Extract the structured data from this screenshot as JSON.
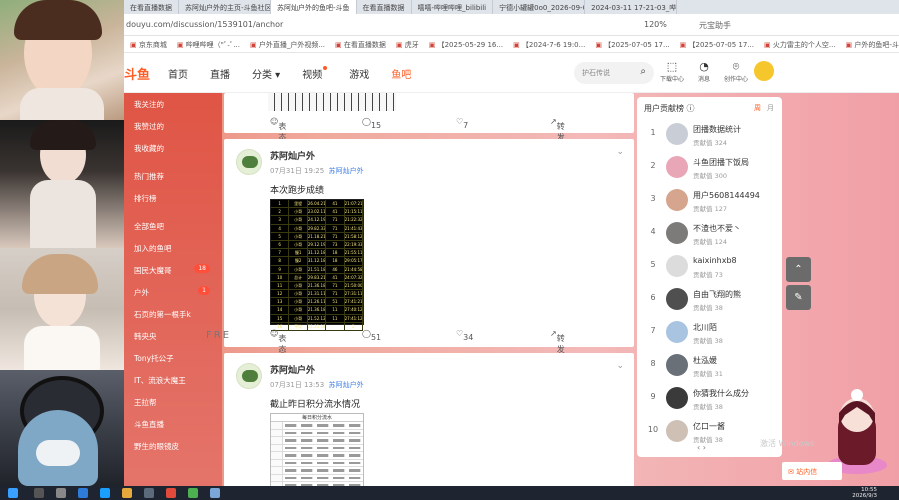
{
  "browser": {
    "tabs": [
      "在看直播数据",
      "苏阿灿户外的主页-斗鱼社区",
      "苏阿灿户外的鱼吧-斗鱼",
      "在看直播数据",
      "嘻嘻-哔哩哔哩_bilibili",
      "宁德小罐罐0o0_2026-09-07",
      "2024-03-11 17-21-03_哔哩..."
    ],
    "url": "douyu.com/discussion/1539101/anchor",
    "zoom": "120%",
    "account": "元宝助手",
    "bookmarks": [
      "京东商城",
      "哔哩哔哩（\"ﾟ-ﾟ...",
      "户外直播_户外视频...",
      "在看直播数据",
      "虎牙",
      "【2025-05-29 16...",
      "【2024-7-6 19:0...",
      "【2025-07-05 17...",
      "【2025-07-05 17...",
      "火力雷主的个人空...",
      "户外的鱼吧-斗鱼"
    ]
  },
  "site": {
    "logo": "斗鱼",
    "nav": [
      "首页",
      "直播",
      "分类",
      "视频",
      "游戏",
      "鱼吧"
    ],
    "search_placeholder": "护石传说",
    "header_icons": [
      "下载中心",
      "消息",
      "创作中心"
    ]
  },
  "sidebar": {
    "items": [
      {
        "label": "我关注的",
        "badge": ""
      },
      {
        "label": "我赞过的",
        "badge": ""
      },
      {
        "label": "我收藏的",
        "badge": ""
      },
      {
        "label": "热门推荐",
        "badge": ""
      },
      {
        "label": "排行榜",
        "badge": ""
      },
      {
        "label": "全部鱼吧",
        "badge": ""
      },
      {
        "label": "加入的鱼吧",
        "badge": ""
      },
      {
        "label": "国民大魔哥",
        "badge": "18"
      },
      {
        "label": "户外",
        "badge": "1"
      },
      {
        "label": "石页的第一根手k",
        "badge": ""
      },
      {
        "label": "韩央央",
        "badge": ""
      },
      {
        "label": "Tony托公子",
        "badge": ""
      },
      {
        "label": "IT、流浪大魔王",
        "badge": ""
      },
      {
        "label": "王拉帮",
        "badge": ""
      },
      {
        "label": "斗鱼直播",
        "badge": ""
      },
      {
        "label": "野生的眼镜皮",
        "badge": ""
      }
    ]
  },
  "feed": {
    "top_actions": {
      "share": "表态",
      "comments": "15",
      "likes": "7",
      "forward": "转发"
    },
    "posts": [
      {
        "author": "苏阿灿户外",
        "time": "07月31日 19:25",
        "tag": "苏阿灿户外",
        "text": "本次跑步成绩",
        "share": "表态",
        "comments": "51",
        "likes": "34",
        "forward": "转发"
      },
      {
        "author": "苏阿灿户外",
        "time": "07月31日 13:53",
        "tag": "苏阿灿户外",
        "text": "截止昨日积分流水情况"
      }
    ],
    "table_rows": [
      [
        "1",
        "里程",
        "26.04.21",
        "41",
        "21:07:21"
      ],
      [
        "2",
        "小哥",
        "23.02.11",
        "41",
        "21:15:11"
      ],
      [
        "3",
        "小哥",
        "24.12.19",
        "71",
        "21:22:32"
      ],
      [
        "4",
        "小哥",
        "29.82.33",
        "71",
        "21:41:43"
      ],
      [
        "5",
        "小哥",
        "21.18.21",
        "71",
        "21:58:12"
      ],
      [
        "6",
        "小哥",
        "29.12.19",
        "73",
        "22:19:33"
      ],
      [
        "7",
        "慢1",
        "31.12.18",
        "18",
        "21:55:11"
      ],
      [
        "8",
        "慢2",
        "31.12.18",
        "18",
        "29:05:17"
      ],
      [
        "9",
        "小哥",
        "21.51.18",
        "46",
        "21:44:58"
      ],
      [
        "10",
        "总计",
        "29.83.21",
        "41",
        "24:07:32"
      ],
      [
        "11",
        "小哥",
        "21.36.18",
        "71",
        "21:50:00"
      ],
      [
        "12",
        "小哥",
        "21.31.11",
        "71",
        "27:31:11"
      ],
      [
        "13",
        "小哥",
        "21.26.11",
        "51",
        "27:41:21"
      ],
      [
        "14",
        "小哥",
        "21.36.18",
        "11",
        "27:40:12"
      ],
      [
        "15",
        "小哥",
        "21.52.12",
        "11",
        "27:41:12"
      ],
      [
        "16",
        "平均",
        "21.31.18",
        "",
        "2"
      ]
    ],
    "table2_title": "每日积分流水"
  },
  "rank": {
    "title": "用户贡献榜",
    "tabs": [
      "周",
      "月"
    ],
    "items": [
      {
        "no": "1",
        "name": "团播数据统计",
        "score": "贡献值 324",
        "color": "#c9ced6"
      },
      {
        "no": "2",
        "name": "斗鱼团播下饭局",
        "score": "贡献值 300",
        "color": "#e9a6b7"
      },
      {
        "no": "3",
        "name": "用户5608144494",
        "score": "贡献值 127",
        "color": "#d6a58e"
      },
      {
        "no": "4",
        "name": "不渣也不爱丶",
        "score": "贡献值 124",
        "color": "#7d7a7a"
      },
      {
        "no": "5",
        "name": "kaixinhxb8",
        "score": "贡献值 73",
        "color": "#dcdcdc"
      },
      {
        "no": "6",
        "name": "自由飞翔的熊",
        "score": "贡献值 38",
        "color": "#4f4f4f"
      },
      {
        "no": "7",
        "name": "北川陌",
        "score": "贡献值 38",
        "color": "#a8c4e1"
      },
      {
        "no": "8",
        "name": "杜泓媛",
        "score": "贡献值 31",
        "color": "#6a7077"
      },
      {
        "no": "9",
        "name": "你猜我什么成分",
        "score": "贡献值 38",
        "color": "#3a3a3a"
      },
      {
        "no": "10",
        "name": "亿口一酱",
        "score": "贡献值 38",
        "color": "#cfc0b6"
      }
    ],
    "pager": "‹  ›"
  },
  "floating": {
    "station_msg": "站内信",
    "activate": "激活 Windows"
  },
  "overlay": {
    "text": "FRE"
  },
  "taskbar": {
    "time": "10:55",
    "date": "2026/9/3"
  }
}
